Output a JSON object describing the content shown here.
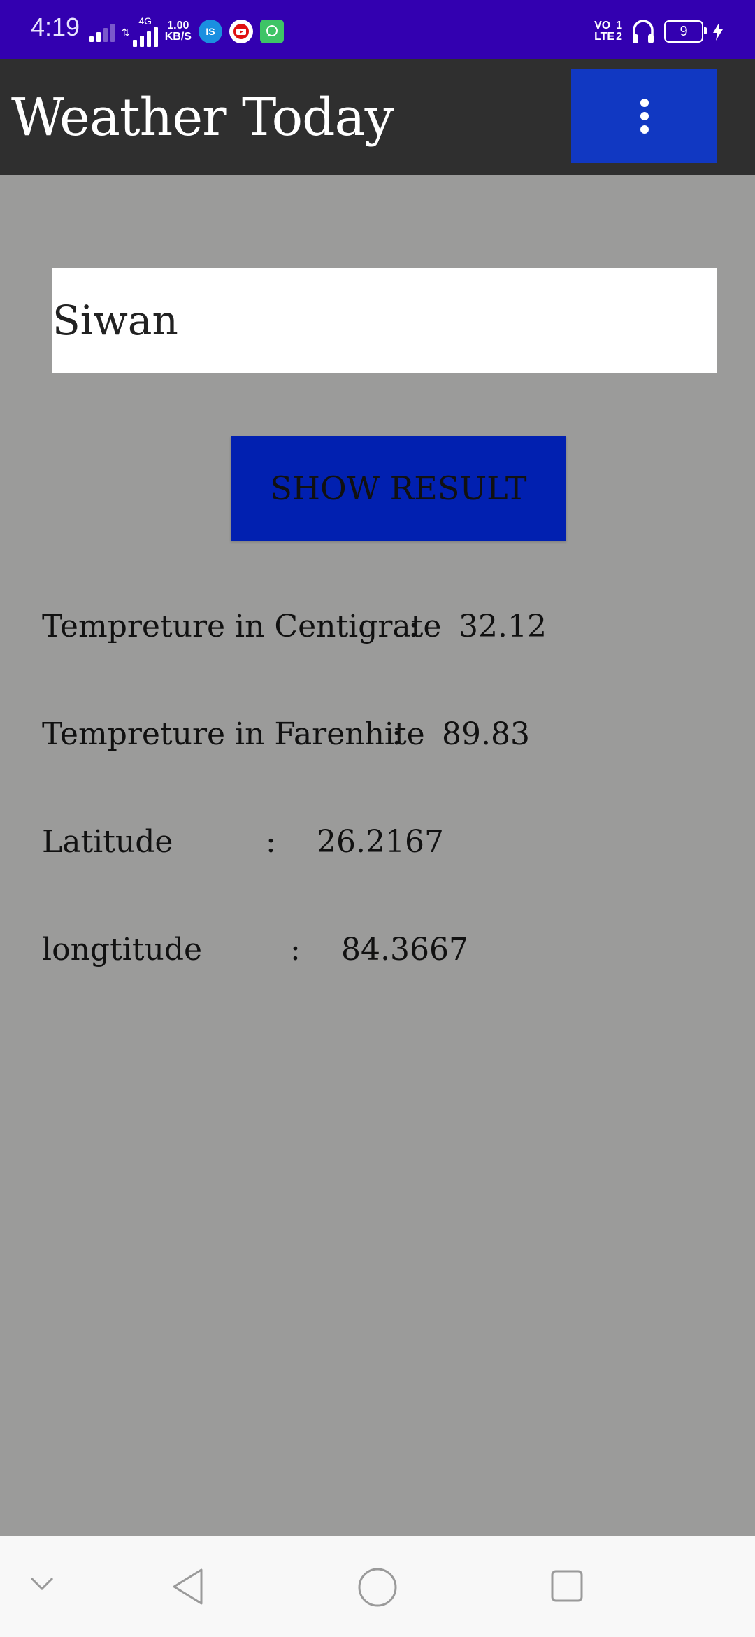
{
  "status_bar": {
    "time": "4:19",
    "network_type": "4G",
    "speed_value": "1.00",
    "speed_unit": "KB/S",
    "app_badge_1": "IS",
    "volte_line1": "VO",
    "volte_line2": "LTE",
    "sim1": "1",
    "sim2": "2",
    "battery": "9"
  },
  "app_bar": {
    "title": "Weather Today"
  },
  "search": {
    "value": "Siwan"
  },
  "actions": {
    "show_result_label": "SHOW RESULT"
  },
  "results": [
    {
      "label": "Tempreture in Centigrate",
      "colon": ":",
      "value": "32.12"
    },
    {
      "label": "Tempreture in Farenhite",
      "colon": ":",
      "value": "89.83"
    },
    {
      "label": "Latitude",
      "colon": ":",
      "value": "26.2167"
    },
    {
      "label": "longtitude",
      "colon": ":",
      "value": "84.3667"
    }
  ],
  "nav_bar": {
    "icons": [
      "chevron-down-icon",
      "back-icon",
      "home-icon",
      "recents-icon"
    ]
  },
  "colors": {
    "status_bar": "#3300b0",
    "app_bar": "#2f2f2f",
    "accent": "#1138c2",
    "button": "#0120b0",
    "background": "#9b9b9a"
  }
}
